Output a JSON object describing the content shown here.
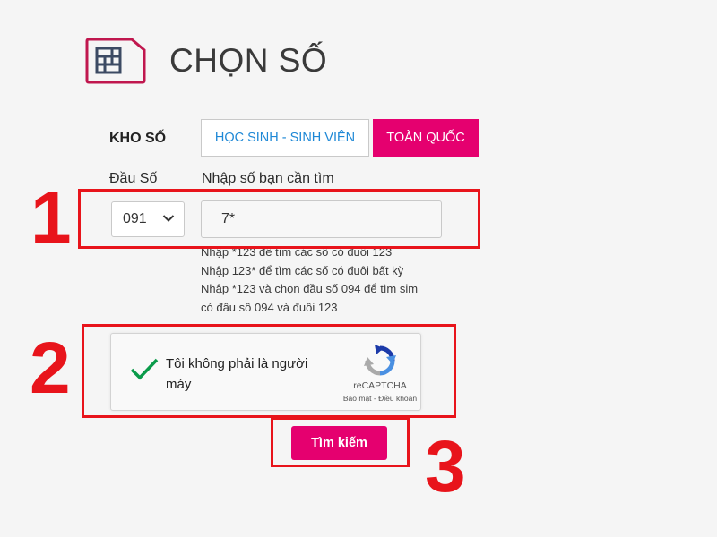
{
  "header": {
    "title": "CHỌN SỐ",
    "icon": "sim-card-icon"
  },
  "kho_so": {
    "label": "KHO SỐ",
    "tabs": [
      {
        "label": "HỌC SINH - SINH VIÊN",
        "active": false
      },
      {
        "label": "TOÀN QUỐC",
        "active": true
      }
    ]
  },
  "search": {
    "prefix_label": "Đầu Số",
    "prefix_value": "091",
    "number_label": "Nhập số bạn cần tìm",
    "number_value": "7*",
    "hints": [
      "Nhập *123 để tìm các số có đuôi 123",
      "Nhập 123* để tìm các số có đuôi bất kỳ",
      "Nhập *123 và chọn đầu số 094 để tìm sim",
      "có đầu số 094 và đuôi 123"
    ]
  },
  "captcha": {
    "text": "Tôi không phải là người máy",
    "checked": true,
    "brand": "reCAPTCHA",
    "links": "Bảo mật - Điều khoản"
  },
  "submit_label": "Tìm kiếm",
  "annotations": [
    "1",
    "2",
    "3"
  ],
  "colors": {
    "accent": "#e5006f",
    "link": "#1e88d6",
    "annotation": "#e8141b",
    "check": "#0a9b4a"
  }
}
